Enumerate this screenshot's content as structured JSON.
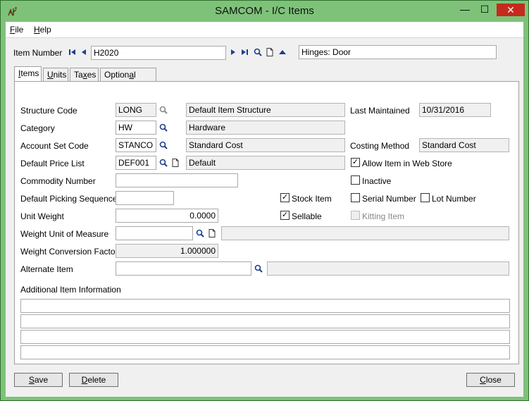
{
  "window": {
    "title": "SAMCOM - I/C Items",
    "controls": {
      "minimize": "—",
      "maximize": "☐",
      "close": "✕"
    }
  },
  "menu": {
    "file": {
      "accel": "F",
      "rest": "ile"
    },
    "help": {
      "accel": "H",
      "rest": "elp"
    }
  },
  "header": {
    "item_number_label": "Item Number",
    "item_number": "H2020",
    "description": "Hinges: Door"
  },
  "tabs": [
    {
      "accel": "I",
      "rest": "tems"
    },
    {
      "accel": "U",
      "rest": "nits"
    },
    {
      "pre": "Ta",
      "accel": "x",
      "rest": "es"
    },
    {
      "pre": "Option",
      "accel": "a",
      "rest": "l Fields"
    }
  ],
  "form": {
    "structure_code": {
      "label": "Structure Code",
      "value": "LONG",
      "desc": "Default Item Structure"
    },
    "category": {
      "label": "Category",
      "value": "HW",
      "desc": "Hardware"
    },
    "account_set_code": {
      "label": "Account Set Code",
      "value": "STANCO",
      "desc": "Standard Cost"
    },
    "default_price_list": {
      "label": "Default Price List",
      "value": "DEF001",
      "desc": "Default"
    },
    "commodity_number": {
      "label": "Commodity Number",
      "value": ""
    },
    "default_picking_sequence": {
      "label": "Default Picking Sequence",
      "value": ""
    },
    "unit_weight": {
      "label": "Unit Weight",
      "value": "0.0000"
    },
    "weight_uom": {
      "label": "Weight Unit of Measure",
      "value": "",
      "desc": ""
    },
    "weight_conversion_factor": {
      "label": "Weight Conversion Factor",
      "value": "1.000000"
    },
    "alternate_item": {
      "label": "Alternate Item",
      "value": "",
      "desc": ""
    },
    "last_maintained": {
      "label": "Last Maintained",
      "value": "10/31/2016"
    },
    "costing_method": {
      "label": "Costing Method",
      "value": "Standard Cost"
    },
    "additional_info_label": "Additional Item Information",
    "additional_info_lines": [
      "",
      "",
      "",
      ""
    ]
  },
  "checkboxes": {
    "allow_web_store": {
      "label": "Allow Item in Web Store",
      "checked": true
    },
    "inactive": {
      "label": "Inactive",
      "checked": false
    },
    "stock_item": {
      "label": "Stock Item",
      "checked": true
    },
    "serial_number": {
      "label": "Serial Number",
      "checked": false
    },
    "lot_number": {
      "label": "Lot Number",
      "checked": false
    },
    "sellable": {
      "label": "Sellable",
      "checked": true
    },
    "kitting_item": {
      "label": "Kitting Item",
      "checked": false,
      "disabled": true
    }
  },
  "buttons": {
    "save": {
      "accel": "S",
      "rest": "ave"
    },
    "delete": {
      "accel": "D",
      "rest": "elete"
    },
    "close": {
      "accel": "C",
      "rest": "lose"
    }
  },
  "colors": {
    "frame": "#7ec27a",
    "close_button": "#c42b1c",
    "nav_arrow": "#1f3f8f"
  },
  "icons": [
    "app-icon",
    "first-record-icon",
    "previous-record-icon",
    "next-record-icon",
    "last-record-icon",
    "finder-icon",
    "new-document-icon",
    "up-arrow-icon"
  ]
}
